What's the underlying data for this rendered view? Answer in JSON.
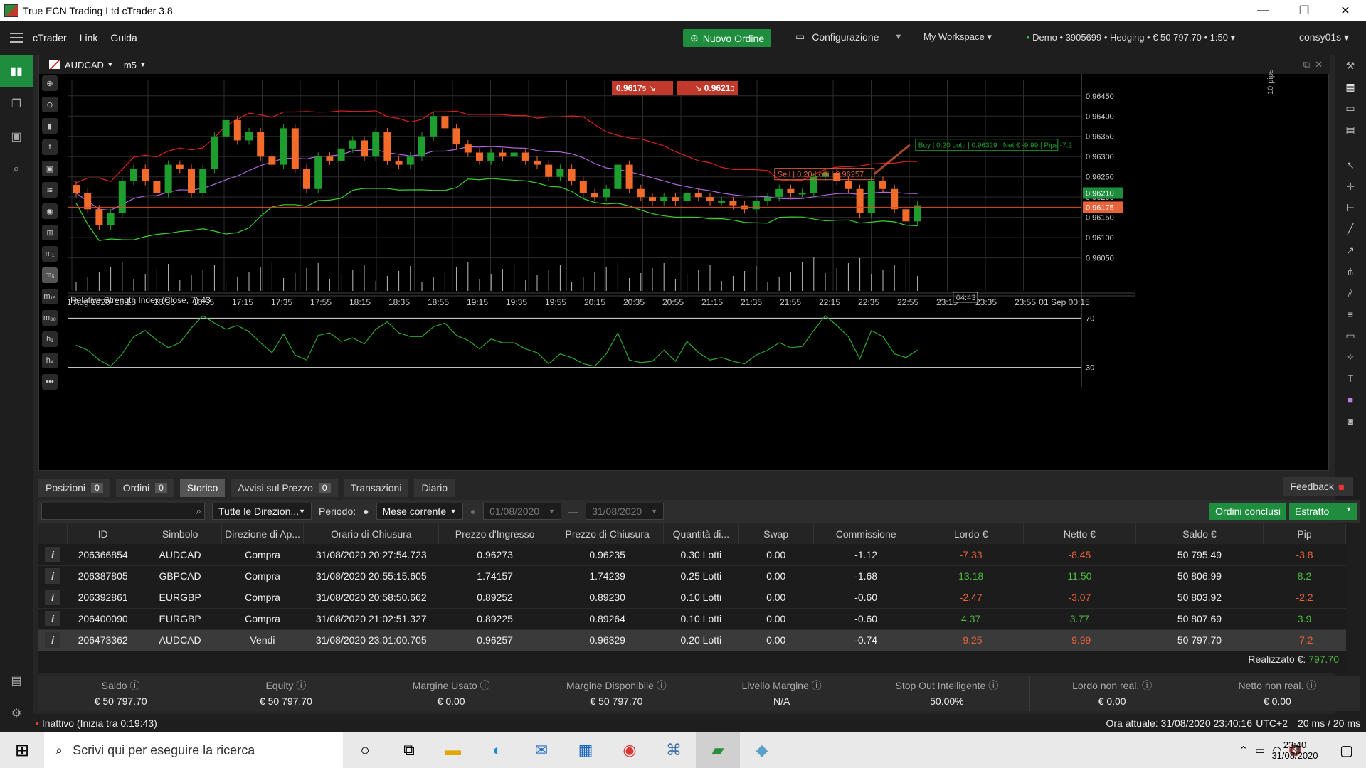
{
  "window": {
    "title": "True ECN Trading Ltd cTrader 3.8",
    "min": "—",
    "max": "❐",
    "close": "✕"
  },
  "menu": {
    "items": [
      "cTrader",
      "Link",
      "Guida"
    ],
    "new_order": "Nuovo Ordine",
    "config": "Configurazione",
    "workspace": "My Workspace ▾",
    "account": "Demo • 3905699 • Hedging • € 50 797.70 • 1:50",
    "user": "consy01s"
  },
  "chart": {
    "symbol": "AUDCAD",
    "timeframe": "m5",
    "sell_price": "0.9617",
    "sell_price_sub": "5",
    "buy_price": "0.9621",
    "buy_price_sub": "0",
    "pips_label": "10 pips",
    "price_ticks": [
      "0.9645",
      "0.9640",
      "0.9635",
      "0.9630",
      "0.9625",
      "0.9620",
      "0.9615",
      "0.9610",
      "0.9605"
    ],
    "price_tick_sub": "0",
    "bid_tag": "0.96210",
    "ask_tag": "0.96175",
    "time_ticks": [
      "31 Aug 2020",
      "16:15",
      "16:35",
      "16:55",
      "17:15",
      "17:35",
      "17:55",
      "18:15",
      "18:35",
      "18:55",
      "19:15",
      "19:35",
      "19:55",
      "20:15",
      "20:35",
      "20:55",
      "21:15",
      "21:35",
      "21:55",
      "22:15",
      "22:35",
      "22:55",
      "23:15",
      "23:35",
      "23:55",
      "01 Sep 00:15"
    ],
    "countdown": "04:43",
    "trade_label": {
      "side": "Sell",
      "lots": "0.20 Lotti",
      "price": "0.96257"
    },
    "trade_close_label": {
      "side": "Buy",
      "lots": "0.20 Lotti",
      "price": "0.96329",
      "net": "Net € -9.99",
      "pips": "Pips -7.2"
    },
    "rsi_title": "Relative Strength Index (Close, 7) 43",
    "rsi_levels": [
      "70",
      "30"
    ],
    "rsi_level_values": [
      70,
      30
    ]
  },
  "chart_data": {
    "type": "candlestick",
    "symbol": "AUDCAD",
    "timeframe": "m5",
    "ylim": [
      0.9603,
      0.9649
    ],
    "candles": [
      [
        0.9623,
        0.9621
      ],
      [
        0.9621,
        0.9617
      ],
      [
        0.9617,
        0.9613
      ],
      [
        0.9613,
        0.9616
      ],
      [
        0.9616,
        0.9624
      ],
      [
        0.9624,
        0.9627
      ],
      [
        0.9627,
        0.9624
      ],
      [
        0.9624,
        0.9621
      ],
      [
        0.9621,
        0.9628
      ],
      [
        0.9628,
        0.9627
      ],
      [
        0.9627,
        0.9621
      ],
      [
        0.9621,
        0.9627
      ],
      [
        0.9627,
        0.9635
      ],
      [
        0.9635,
        0.9639
      ],
      [
        0.9639,
        0.9634
      ],
      [
        0.9634,
        0.9636
      ],
      [
        0.9636,
        0.963
      ],
      [
        0.963,
        0.9628
      ],
      [
        0.9628,
        0.9637
      ],
      [
        0.9637,
        0.9627
      ],
      [
        0.9627,
        0.9622
      ],
      [
        0.9622,
        0.963
      ],
      [
        0.963,
        0.9629
      ],
      [
        0.9629,
        0.9632
      ],
      [
        0.9632,
        0.9634
      ],
      [
        0.9634,
        0.963
      ],
      [
        0.963,
        0.9636
      ],
      [
        0.9636,
        0.9629
      ],
      [
        0.9629,
        0.9628
      ],
      [
        0.9628,
        0.963
      ],
      [
        0.963,
        0.9635
      ],
      [
        0.9635,
        0.964
      ],
      [
        0.964,
        0.9637
      ],
      [
        0.9637,
        0.9633
      ],
      [
        0.9633,
        0.9631
      ],
      [
        0.9631,
        0.9629
      ],
      [
        0.9629,
        0.9631
      ],
      [
        0.9631,
        0.963
      ],
      [
        0.963,
        0.9631
      ],
      [
        0.9631,
        0.9629
      ],
      [
        0.9629,
        0.9628
      ],
      [
        0.9628,
        0.9625
      ],
      [
        0.9625,
        0.9627
      ],
      [
        0.9627,
        0.9624
      ],
      [
        0.9624,
        0.9621
      ],
      [
        0.9621,
        0.962
      ],
      [
        0.962,
        0.9622
      ],
      [
        0.9622,
        0.9628
      ],
      [
        0.9628,
        0.9622
      ],
      [
        0.9622,
        0.962
      ],
      [
        0.962,
        0.9619
      ],
      [
        0.9619,
        0.962
      ],
      [
        0.962,
        0.9619
      ],
      [
        0.9619,
        0.9621
      ],
      [
        0.9621,
        0.962
      ],
      [
        0.962,
        0.9619
      ],
      [
        0.9619,
        0.9619
      ],
      [
        0.9619,
        0.9618
      ],
      [
        0.9618,
        0.9617
      ],
      [
        0.9617,
        0.9619
      ],
      [
        0.9619,
        0.962
      ],
      [
        0.962,
        0.9622
      ],
      [
        0.9622,
        0.9621
      ],
      [
        0.9621,
        0.9621
      ],
      [
        0.9621,
        0.9625
      ],
      [
        0.9625,
        0.9626
      ],
      [
        0.9626,
        0.9624
      ],
      [
        0.9624,
        0.9622
      ],
      [
        0.9622,
        0.9616
      ],
      [
        0.9616,
        0.9624
      ],
      [
        0.9624,
        0.9622
      ],
      [
        0.9622,
        0.9617
      ],
      [
        0.9617,
        0.9614
      ],
      [
        0.9614,
        0.9618
      ]
    ],
    "volume_note": "volume histogram",
    "rsi": [
      48,
      44,
      36,
      31,
      41,
      55,
      60,
      52,
      46,
      50,
      62,
      72,
      66,
      61,
      64,
      59,
      50,
      42,
      57,
      40,
      36,
      56,
      58,
      51,
      54,
      49,
      61,
      67,
      58,
      55,
      55,
      63,
      66,
      56,
      52,
      45,
      53,
      50,
      50,
      45,
      42,
      33,
      41,
      38,
      33,
      31,
      41,
      58,
      36,
      34,
      35,
      44,
      35,
      51,
      42,
      36,
      38,
      35,
      33,
      40,
      44,
      50,
      46,
      47,
      60,
      72,
      64,
      55,
      37,
      60,
      55,
      41,
      38,
      44
    ]
  },
  "tabs": [
    {
      "label": "Posizioni",
      "count": "0"
    },
    {
      "label": "Ordini",
      "count": "0"
    },
    {
      "label": "Storico",
      "count": ""
    },
    {
      "label": "Avvisi sul Prezzo",
      "count": "0"
    },
    {
      "label": "Transazioni",
      "count": ""
    },
    {
      "label": "Diario",
      "count": ""
    }
  ],
  "feedback": "Feedback",
  "filters": {
    "search_placeholder": "",
    "direction": "Tutte le Direzion...",
    "period_label": "Periodo:",
    "period": "Mese corrente",
    "date_from": "01/08/2020",
    "date_to": "31/08/2020",
    "closed_orders": "Ordini conclusi",
    "extract": "Estratto"
  },
  "history": {
    "columns": [
      "ID",
      "Simbolo",
      "Direzione di Ap...",
      "Orario di Chiusura",
      "Prezzo d'Ingresso",
      "Prezzo di Chiusura",
      "Quantità di...",
      "Swap",
      "Commissione",
      "Lordo €",
      "Netto €",
      "Saldo €",
      "Pip"
    ],
    "rows": [
      [
        "206366854",
        "AUDCAD",
        "Compra",
        "31/08/2020 20:27:54.723",
        "0.96273",
        "0.96235",
        "0.30 Lotti",
        "0.00",
        "-1.12",
        "-7.33",
        "-8.45",
        "50 795.49",
        "-3.8"
      ],
      [
        "206387805",
        "GBPCAD",
        "Compra",
        "31/08/2020 20:55:15.605",
        "1.74157",
        "1.74239",
        "0.25 Lotti",
        "0.00",
        "-1.68",
        "13.18",
        "11.50",
        "50 806.99",
        "8.2"
      ],
      [
        "206392861",
        "EURGBP",
        "Compra",
        "31/08/2020 20:58:50.662",
        "0.89252",
        "0.89230",
        "0.10 Lotti",
        "0.00",
        "-0.60",
        "-2.47",
        "-3.07",
        "50 803.92",
        "-2.2"
      ],
      [
        "206400090",
        "EURGBP",
        "Compra",
        "31/08/2020 21:02:51.327",
        "0.89225",
        "0.89264",
        "0.10 Lotti",
        "0.00",
        "-0.60",
        "4.37",
        "3.77",
        "50 807.69",
        "3.9"
      ],
      [
        "206473362",
        "AUDCAD",
        "Vendi",
        "31/08/2020 23:01:00.705",
        "0.96257",
        "0.96329",
        "0.20 Lotti",
        "0.00",
        "-0.74",
        "-9.25",
        "-9.99",
        "50 797.70",
        "-7.2"
      ]
    ],
    "realized_label": "Realizzato €:",
    "realized_value": "797.70"
  },
  "summary": [
    {
      "label": "Saldo",
      "value": "€ 50 797.70"
    },
    {
      "label": "Equity",
      "value": "€ 50 797.70"
    },
    {
      "label": "Margine Usato",
      "value": "€ 0.00"
    },
    {
      "label": "Margine Disponibile",
      "value": "€ 50 797.70"
    },
    {
      "label": "Livello Margine",
      "value": "N/A"
    },
    {
      "label": "Stop Out Intelligente",
      "value": "50.00%"
    },
    {
      "label": "Lordo non real.",
      "value": "€ 0.00"
    },
    {
      "label": "Netto non real.",
      "value": "€ 0.00"
    }
  ],
  "status": {
    "inactive": "Inattivo (Inizia tra 0:19:43)",
    "time": "Ora attuale: 31/08/2020 23:40:16",
    "tz": "UTC+2",
    "latency": "20 ms / 20 ms"
  },
  "taskbar": {
    "search": "Scrivi qui per eseguire la ricerca",
    "time": "23:40",
    "date": "31/08/2020"
  },
  "colors": {
    "up": "#1e9e2e",
    "down": "#f36b2a",
    "band_top": "#e02020",
    "band_bottom": "#3bd02e",
    "mid": "#b066e0"
  }
}
